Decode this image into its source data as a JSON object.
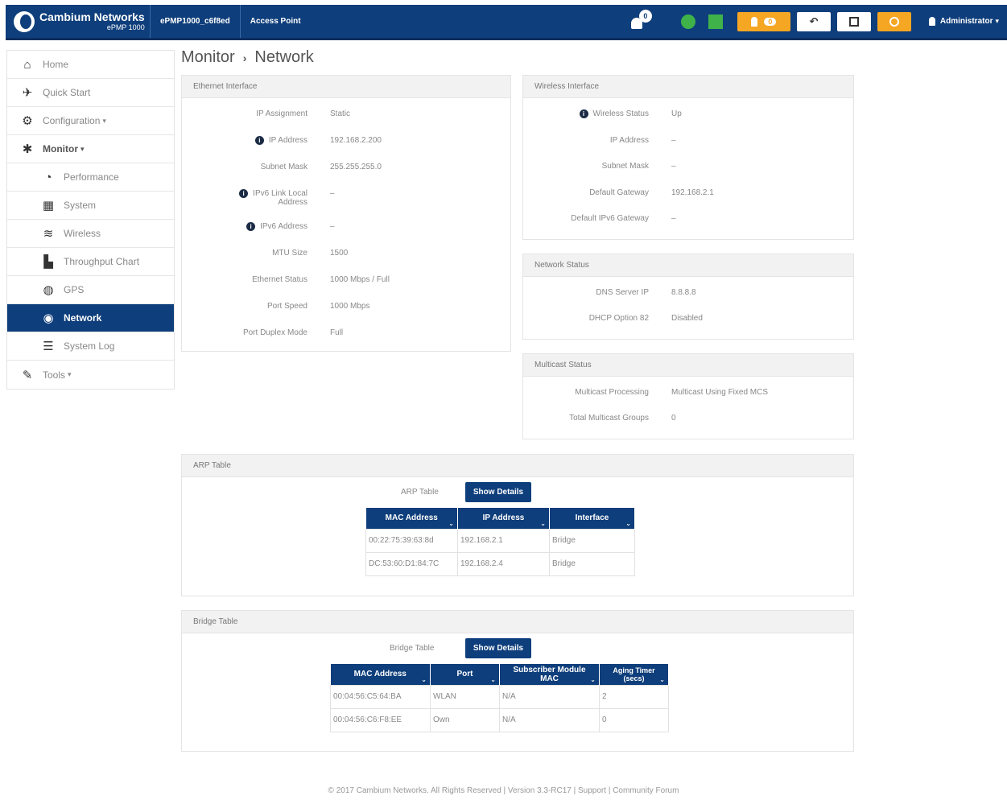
{
  "header": {
    "brand_name": "Cambium Networks",
    "brand_model": "ePMP 1000",
    "device_name": "ePMP1000_c6f8ed",
    "device_mode": "Access Point",
    "alert_count": "0",
    "alarm_count": "0",
    "undo_glyph": "↶",
    "user_label": "Administrator",
    "user_caret": "▾"
  },
  "sidebar": {
    "items": [
      {
        "label": "Home",
        "icon": "home-icon",
        "glyph": "⌂"
      },
      {
        "label": "Quick Start",
        "icon": "quick-start-icon",
        "glyph": "✈"
      },
      {
        "label": "Configuration",
        "icon": "gear-icon",
        "glyph": "⚙",
        "caret": "▾"
      },
      {
        "label": "Monitor",
        "icon": "monitor-icon",
        "glyph": "✱",
        "caret": "▾"
      },
      {
        "label": "Performance",
        "icon": "performance-icon",
        "glyph": "◔"
      },
      {
        "label": "System",
        "icon": "system-icon",
        "glyph": "▦"
      },
      {
        "label": "Wireless",
        "icon": "wireless-icon",
        "glyph": "≋"
      },
      {
        "label": "Throughput Chart",
        "icon": "chart-icon",
        "glyph": "▙"
      },
      {
        "label": "GPS",
        "icon": "gps-icon",
        "glyph": "◍"
      },
      {
        "label": "Network",
        "icon": "network-icon",
        "glyph": "◉"
      },
      {
        "label": "System Log",
        "icon": "log-icon",
        "glyph": "☰"
      },
      {
        "label": "Tools",
        "icon": "tools-icon",
        "glyph": "✎",
        "caret": "▾"
      }
    ]
  },
  "breadcrumb": {
    "section": "Monitor",
    "separator": "›",
    "page": "Network"
  },
  "ethernet": {
    "title": "Ethernet Interface",
    "rows": [
      {
        "label": "IP Assignment",
        "value": "Static",
        "info": false
      },
      {
        "label": "IP Address",
        "value": "192.168.2.200",
        "info": true
      },
      {
        "label": "Subnet Mask",
        "value": "255.255.255.0",
        "info": false
      },
      {
        "label": "IPv6 Link Local Address",
        "value": "–",
        "info": true
      },
      {
        "label": "IPv6 Address",
        "value": "–",
        "info": true
      },
      {
        "label": "MTU Size",
        "value": "1500",
        "info": false
      },
      {
        "label": "Ethernet Status",
        "value": "1000 Mbps / Full",
        "info": false
      },
      {
        "label": "Port Speed",
        "value": "1000 Mbps",
        "info": false
      },
      {
        "label": "Port Duplex Mode",
        "value": "Full",
        "info": false
      }
    ]
  },
  "wireless": {
    "title": "Wireless Interface",
    "rows": [
      {
        "label": "Wireless Status",
        "value": "Up",
        "info": true
      },
      {
        "label": "IP Address",
        "value": "–",
        "info": false
      },
      {
        "label": "Subnet Mask",
        "value": "–",
        "info": false
      },
      {
        "label": "Default Gateway",
        "value": "192.168.2.1",
        "info": false
      },
      {
        "label": "Default IPv6 Gateway",
        "value": "–",
        "info": false
      }
    ]
  },
  "network_status": {
    "title": "Network Status",
    "rows": [
      {
        "label": "DNS Server IP",
        "value": "8.8.8.8"
      },
      {
        "label": "DHCP Option 82",
        "value": "Disabled"
      }
    ]
  },
  "multicast": {
    "title": "Multicast Status",
    "rows": [
      {
        "label": "Multicast Processing",
        "value": "Multicast Using Fixed MCS"
      },
      {
        "label": "Total Multicast Groups",
        "value": "0"
      }
    ]
  },
  "arp": {
    "title": "ARP Table",
    "table_label": "ARP Table",
    "button": "Show Details",
    "columns": [
      "MAC Address",
      "IP Address",
      "Interface"
    ],
    "rows": [
      [
        "00:22:75:39:63:8d",
        "192.168.2.1",
        "Bridge"
      ],
      [
        "DC:53:60:D1:84:7C",
        "192.168.2.4",
        "Bridge"
      ]
    ]
  },
  "bridge": {
    "title": "Bridge Table",
    "table_label": "Bridge Table",
    "button": "Show Details",
    "columns": [
      "MAC Address",
      "Port",
      "Subscriber Module MAC",
      "Aging Timer (secs)"
    ],
    "rows": [
      [
        "00:04:56:C5:64:BA",
        "WLAN",
        "N/A",
        "2"
      ],
      [
        "00:04:56:C6:F8:EE",
        "Own",
        "N/A",
        "0"
      ]
    ]
  },
  "footer": {
    "text": "© 2017 Cambium Networks. All Rights Reserved | Version 3.3-RC17 | Support | Community Forum"
  }
}
